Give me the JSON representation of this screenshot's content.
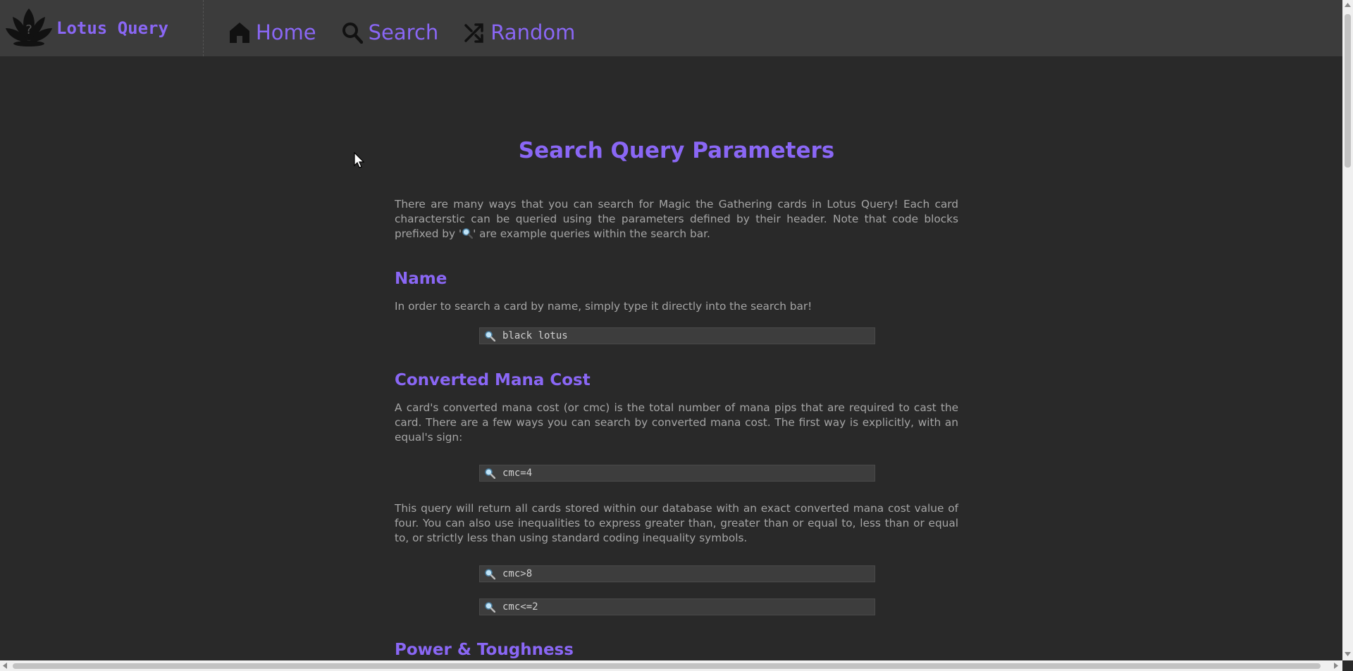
{
  "brand": {
    "name": "Lotus Query",
    "logo_icon": "lotus-logo-icon"
  },
  "nav": [
    {
      "label": "Home",
      "icon": "home-icon"
    },
    {
      "label": "Search",
      "icon": "search-icon"
    },
    {
      "label": "Random",
      "icon": "shuffle-icon"
    }
  ],
  "page": {
    "title": "Search Query Parameters",
    "intro": {
      "before": "There are many ways that you can search for Magic the Gathering cards in Lotus Query! Each card characterstic can be queried using the parameters defined by their header. Note that code blocks prefixed by '",
      "after": "' are example queries within the search bar."
    },
    "sections": {
      "name": {
        "title": "Name",
        "text": "In order to search a card by name, simply type it directly into the search bar!",
        "query": "black lotus"
      },
      "cmc": {
        "title": "Converted Mana Cost",
        "text1": "A card's converted mana cost (or cmc) is the total number of mana pips that are required to cast the card. There are a few ways you can search by converted mana cost. The first way is explicitly, with an equal's sign:",
        "query1": "cmc=4",
        "text2": "This query will return all cards stored within our database with an exact converted mana cost value of four. You can also use inequalities to express greater than, greater than or equal to, less than or equal to, or strictly less than using standard coding inequality symbols.",
        "query2": "cmc>8",
        "query3": "cmc<=2"
      },
      "power": {
        "title": "Power & Toughness"
      }
    }
  },
  "colors": {
    "accent": "#8a67f5",
    "background": "#292929",
    "topbar": "#3c3c3c"
  }
}
